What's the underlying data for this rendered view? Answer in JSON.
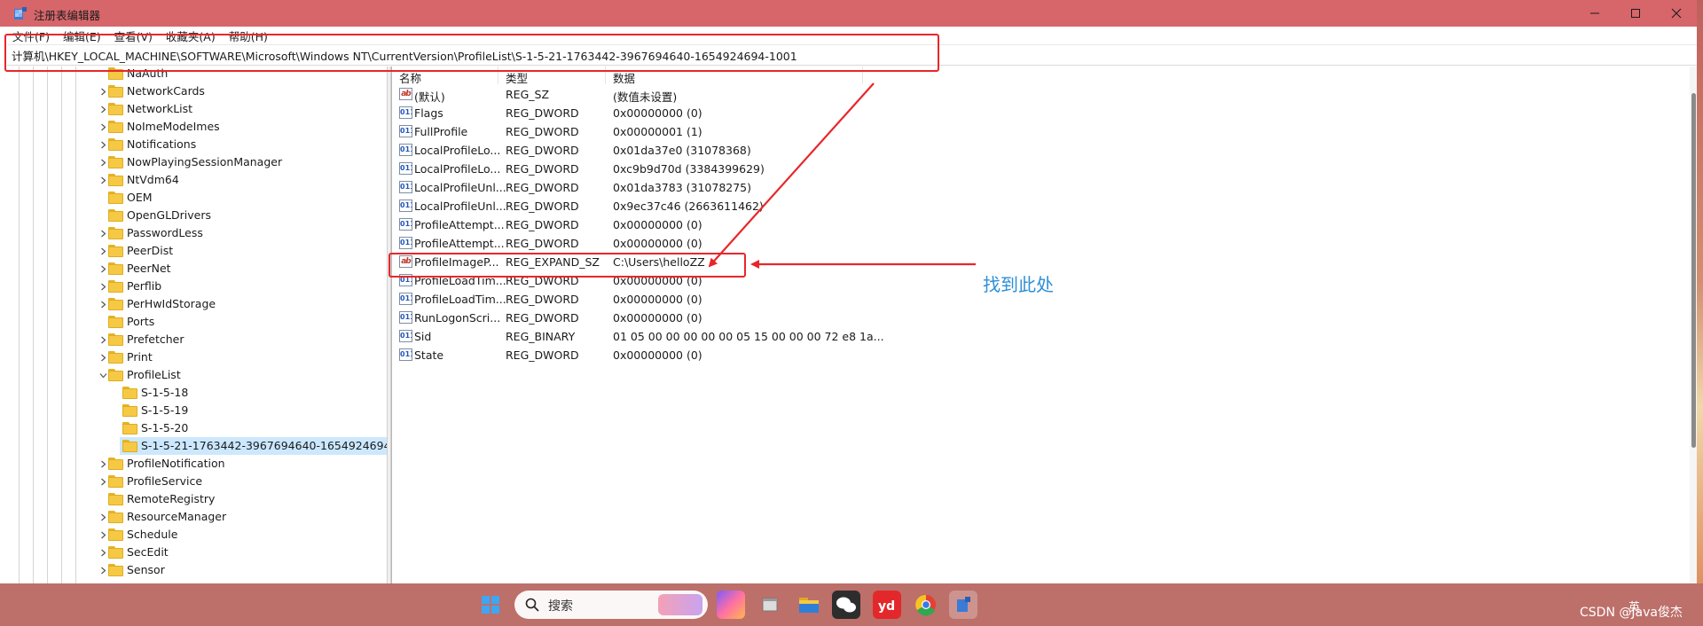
{
  "window": {
    "title": "注册表编辑器"
  },
  "menu": [
    "文件(F)",
    "编辑(E)",
    "查看(V)",
    "收藏夹(A)",
    "帮助(H)"
  ],
  "address": "计算机\\HKEY_LOCAL_MACHINE\\SOFTWARE\\Microsoft\\Windows NT\\CurrentVersion\\ProfileList\\S-1-5-21-1763442-3967694640-1654924694-1001",
  "tree": [
    {
      "label": "NaAuth",
      "expanded": false,
      "children": false
    },
    {
      "label": "NetworkCards",
      "expanded": false,
      "children": true
    },
    {
      "label": "NetworkList",
      "expanded": false,
      "children": true
    },
    {
      "label": "NoImeModeImes",
      "expanded": false,
      "children": true
    },
    {
      "label": "Notifications",
      "expanded": false,
      "children": true
    },
    {
      "label": "NowPlayingSessionManager",
      "expanded": false,
      "children": true
    },
    {
      "label": "NtVdm64",
      "expanded": false,
      "children": true
    },
    {
      "label": "OEM",
      "expanded": false,
      "children": false
    },
    {
      "label": "OpenGLDrivers",
      "expanded": false,
      "children": false
    },
    {
      "label": "PasswordLess",
      "expanded": false,
      "children": true
    },
    {
      "label": "PeerDist",
      "expanded": false,
      "children": true
    },
    {
      "label": "PeerNet",
      "expanded": false,
      "children": true
    },
    {
      "label": "Perflib",
      "expanded": false,
      "children": true
    },
    {
      "label": "PerHwIdStorage",
      "expanded": false,
      "children": true
    },
    {
      "label": "Ports",
      "expanded": false,
      "children": false
    },
    {
      "label": "Prefetcher",
      "expanded": false,
      "children": true
    },
    {
      "label": "Print",
      "expanded": false,
      "children": true
    },
    {
      "label": "ProfileList",
      "expanded": true,
      "children": true
    },
    {
      "label": "S-1-5-18",
      "child": true
    },
    {
      "label": "S-1-5-19",
      "child": true
    },
    {
      "label": "S-1-5-20",
      "child": true
    },
    {
      "label": "S-1-5-21-1763442-3967694640-1654924694-",
      "child": true,
      "selected": true
    },
    {
      "label": "ProfileNotification",
      "expanded": false,
      "children": true
    },
    {
      "label": "ProfileService",
      "expanded": false,
      "children": true
    },
    {
      "label": "RemoteRegistry",
      "expanded": false,
      "children": false
    },
    {
      "label": "ResourceManager",
      "expanded": false,
      "children": true
    },
    {
      "label": "Schedule",
      "expanded": false,
      "children": true
    },
    {
      "label": "SecEdit",
      "expanded": false,
      "children": true
    },
    {
      "label": "Sensor",
      "expanded": false,
      "children": true
    }
  ],
  "columns": {
    "name": "名称",
    "type": "类型",
    "data": "数据"
  },
  "values": [
    {
      "icon": "string-value-icon",
      "name": "(默认)",
      "type": "REG_SZ",
      "data": "(数值未设置)"
    },
    {
      "icon": "dword-value-icon",
      "name": "Flags",
      "type": "REG_DWORD",
      "data": "0x00000000 (0)"
    },
    {
      "icon": "dword-value-icon",
      "name": "FullProfile",
      "type": "REG_DWORD",
      "data": "0x00000001 (1)"
    },
    {
      "icon": "dword-value-icon",
      "name": "LocalProfileLo...",
      "type": "REG_DWORD",
      "data": "0x01da37e0 (31078368)"
    },
    {
      "icon": "dword-value-icon",
      "name": "LocalProfileLo...",
      "type": "REG_DWORD",
      "data": "0xc9b9d70d (3384399629)"
    },
    {
      "icon": "dword-value-icon",
      "name": "LocalProfileUnl...",
      "type": "REG_DWORD",
      "data": "0x01da3783 (31078275)"
    },
    {
      "icon": "dword-value-icon",
      "name": "LocalProfileUnl...",
      "type": "REG_DWORD",
      "data": "0x9ec37c46 (2663611462)"
    },
    {
      "icon": "dword-value-icon",
      "name": "ProfileAttempt...",
      "type": "REG_DWORD",
      "data": "0x00000000 (0)"
    },
    {
      "icon": "dword-value-icon",
      "name": "ProfileAttempt...",
      "type": "REG_DWORD",
      "data": "0x00000000 (0)"
    },
    {
      "icon": "string-value-icon",
      "name": "ProfileImageP...",
      "type": "REG_EXPAND_SZ",
      "data": "C:\\Users\\helloZZ"
    },
    {
      "icon": "dword-value-icon",
      "name": "ProfileLoadTim...",
      "type": "REG_DWORD",
      "data": "0x00000000 (0)"
    },
    {
      "icon": "dword-value-icon",
      "name": "ProfileLoadTim...",
      "type": "REG_DWORD",
      "data": "0x00000000 (0)"
    },
    {
      "icon": "dword-value-icon",
      "name": "RunLogonScri...",
      "type": "REG_DWORD",
      "data": "0x00000000 (0)"
    },
    {
      "icon": "binary-value-icon",
      "name": "Sid",
      "type": "REG_BINARY",
      "data": "01 05 00 00 00 00 00 05 15 00 00 00 72 e8 1a..."
    },
    {
      "icon": "dword-value-icon",
      "name": "State",
      "type": "REG_DWORD",
      "data": "0x00000000 (0)"
    }
  ],
  "annotation": "找到此处",
  "taskbar": {
    "search_label": "搜索",
    "tray_ime": "英",
    "watermark": "CSDN @Java俊杰"
  },
  "colors": {
    "titlebar": "#d6666a",
    "highlight": "#e8262a",
    "annotation": "#2e8fd8",
    "taskbar": "#bd6f6a",
    "selection": "#cce8ff"
  }
}
